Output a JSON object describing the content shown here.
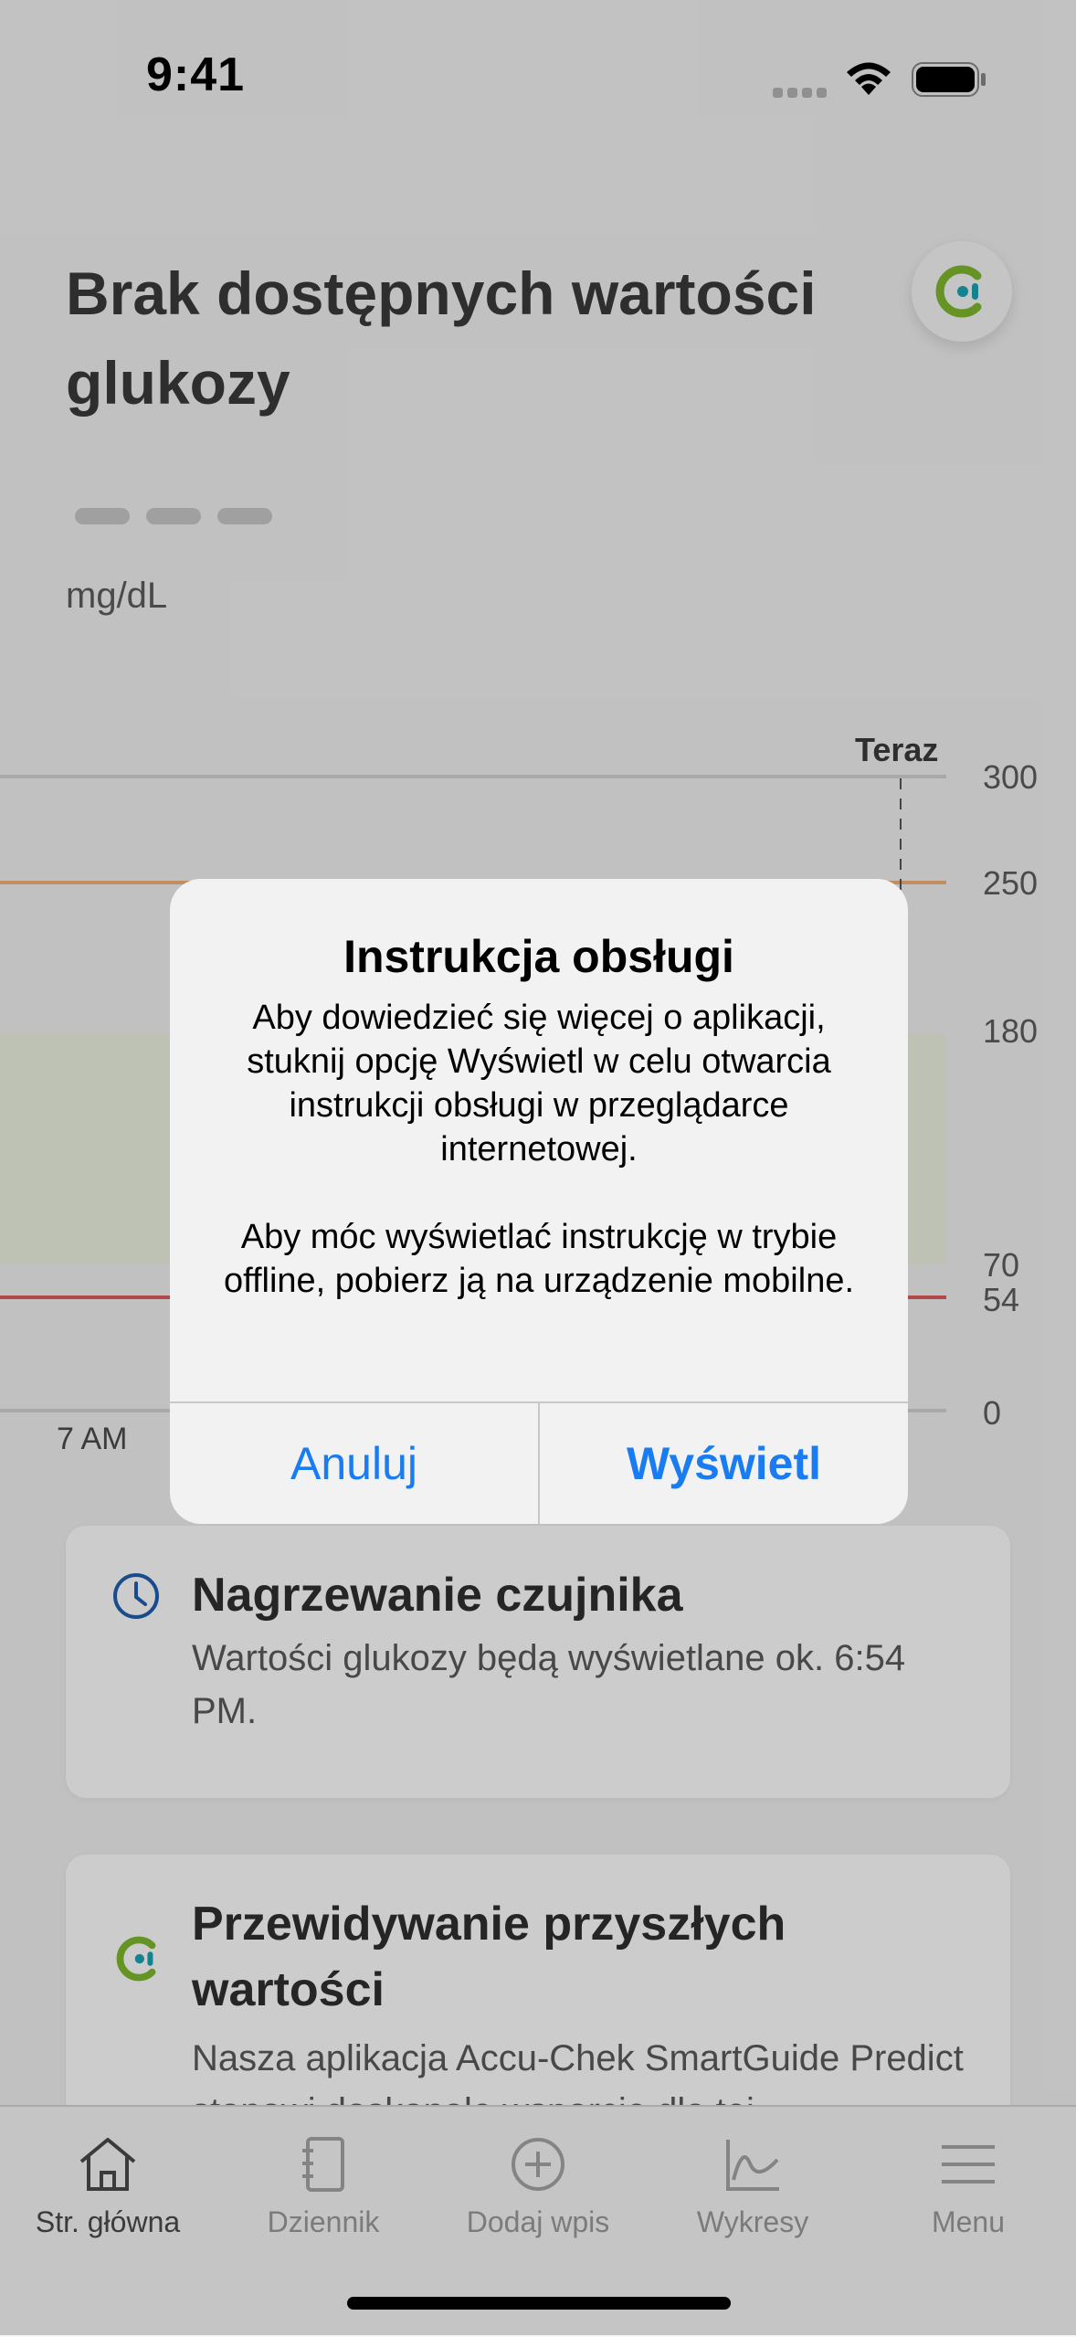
{
  "status_bar": {
    "time": "9:41"
  },
  "header": {
    "title": "Brak dostępnych wartości glukozy",
    "unit": "mg/dL"
  },
  "chart": {
    "now_label": "Teraz",
    "x_label": "7 AM",
    "y_ticks": [
      "300",
      "250",
      "180",
      "70",
      "54",
      "0"
    ]
  },
  "cards": [
    {
      "title": "Nagrzewanie czujnika",
      "text": "Wartości glukozy będą wyświetlane ok. 6:54 PM.",
      "icon": "clock-icon"
    },
    {
      "title": "Przewidywanie przyszłych wartości",
      "text": "Nasza aplikacja Accu-Chek SmartGuide Predict stanowi doskonałe wsparcie dla tej",
      "icon": "accu-chek-logo-icon"
    }
  ],
  "tabs": [
    {
      "label": "Str. główna",
      "icon": "home-icon",
      "active": true
    },
    {
      "label": "Dziennik",
      "icon": "journal-icon",
      "active": false
    },
    {
      "label": "Dodaj wpis",
      "icon": "add-circle-icon",
      "active": false
    },
    {
      "label": "Wykresy",
      "icon": "chart-icon",
      "active": false
    },
    {
      "label": "Menu",
      "icon": "menu-icon",
      "active": false
    }
  ],
  "alert": {
    "title": "Instrukcja obsługi",
    "message_1": "Aby dowiedzieć się więcej o aplikacji, stuknij opcję Wyświetl w celu otwarcia instrukcji obsługi w przeglądarce internetowej.",
    "message_2": "Aby móc wyświetlać instrukcję w trybie offline, pobierz ją na urządzenie mobilne.",
    "cancel_label": "Anuluj",
    "ok_label": "Wyświetl"
  },
  "colors": {
    "accent": "#1a7cf2",
    "logo_green": "#7fb82e",
    "logo_teal": "#1aa3b3",
    "target_range": "#eef3e2",
    "high_line": "#f3b27a",
    "low_line": "#e05b5b"
  }
}
